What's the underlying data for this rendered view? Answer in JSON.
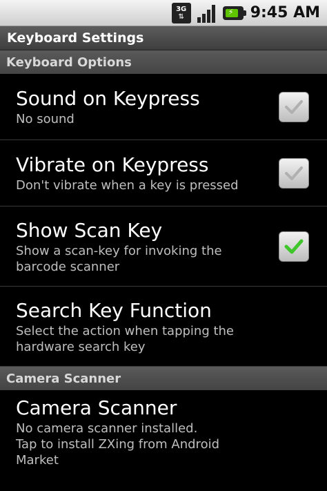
{
  "status_bar": {
    "network": "3G",
    "time": "9:45 AM"
  },
  "title_bar": {
    "title": "Keyboard Settings"
  },
  "categories": {
    "keyboard_options": "Keyboard Options",
    "camera_scanner": "Camera Scanner"
  },
  "preferences": {
    "sound": {
      "title": "Sound on Keypress",
      "summary": "No sound",
      "checked": false
    },
    "vibrate": {
      "title": "Vibrate on Keypress",
      "summary": "Don't vibrate when a key is pressed",
      "checked": false
    },
    "scan_key": {
      "title": "Show Scan Key",
      "summary": "Show a scan-key for invoking the barcode scanner",
      "checked": true
    },
    "search_key": {
      "title": "Search Key Function",
      "summary": "Select the action when tapping the hardware search key"
    },
    "camera_scanner": {
      "title": "Camera Scanner",
      "summary_line1": "No camera scanner installed.",
      "summary_line2": "Tap to install ZXing from Android Market"
    }
  },
  "colors": {
    "check_on": "#3ec62a",
    "check_off": "#b0b0b0"
  }
}
